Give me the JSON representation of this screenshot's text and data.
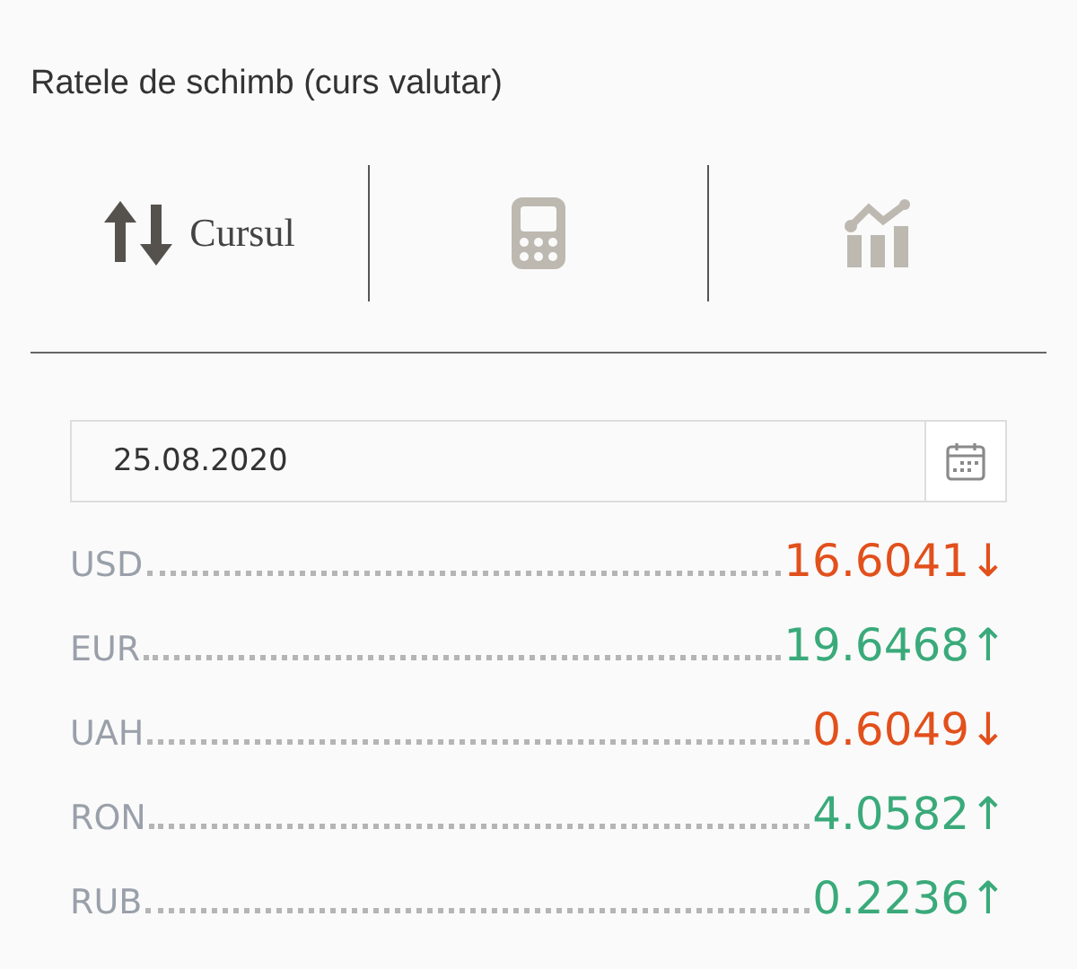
{
  "title": "Ratele de schimb (curs valutar)",
  "tabs": [
    {
      "kind": "exchange",
      "label": "Cursul",
      "selected": true
    },
    {
      "kind": "calculator",
      "selected": false
    },
    {
      "kind": "chart",
      "selected": false
    }
  ],
  "date_field": {
    "value": "25.08.2020"
  },
  "rates": [
    {
      "code": "USD",
      "value": "16.6041",
      "arrow": "↓",
      "rising": false
    },
    {
      "code": "EUR",
      "value": "19.6468",
      "arrow": "↑",
      "rising": true
    },
    {
      "code": "UAH",
      "value": "0.6049",
      "arrow": "↓",
      "rising": false
    },
    {
      "code": "RON",
      "value": "4.0582",
      "arrow": "↑",
      "rising": true
    },
    {
      "code": "RUB",
      "value": "0.2236",
      "arrow": "↑",
      "rising": true
    }
  ]
}
